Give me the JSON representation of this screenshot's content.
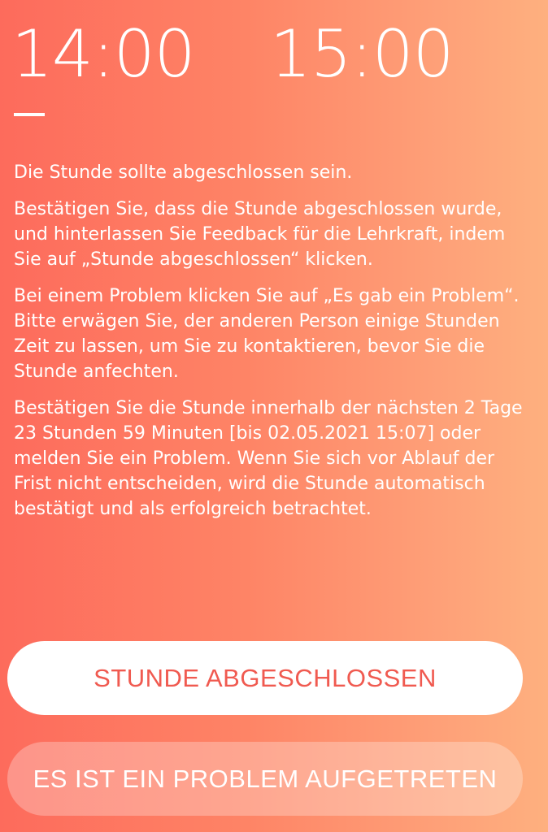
{
  "lesson": {
    "start_time": "14:00",
    "end_time": "15:00"
  },
  "message": {
    "paragraphs": [
      "Die Stunde sollte abgeschlossen sein.",
      "Bestätigen Sie, dass die Stunde abgeschlossen wurde, und hinterlassen Sie Feedback für die Lehrkraft, indem Sie auf „Stunde abgeschlossen“ klicken.",
      "Bei einem Problem klicken Sie auf „Es gab ein Problem“. Bitte erwägen Sie, der anderen Person einige Stunden Zeit zu lassen, um Sie zu kontaktieren, bevor Sie die Stunde anfechten.",
      "Bestätigen Sie die Stunde innerhalb der nächsten 2 Tage 23 Stunden 59 Minuten [bis 02.05.2021 15:07] oder melden Sie ein Problem. Wenn Sie sich vor Ablauf der Frist nicht entscheiden, wird die Stunde automatisch bestätigt und als erfolgreich betrachtet."
    ]
  },
  "actions": {
    "confirm_label": "STUNDE ABGESCHLOSSEN",
    "problem_label": "ES IST EIN PROBLEM AUFGETRETEN"
  },
  "colors": {
    "gradient_start": "#fd6b5c",
    "gradient_end": "#feb07f",
    "accent_text": "#f05a50"
  }
}
